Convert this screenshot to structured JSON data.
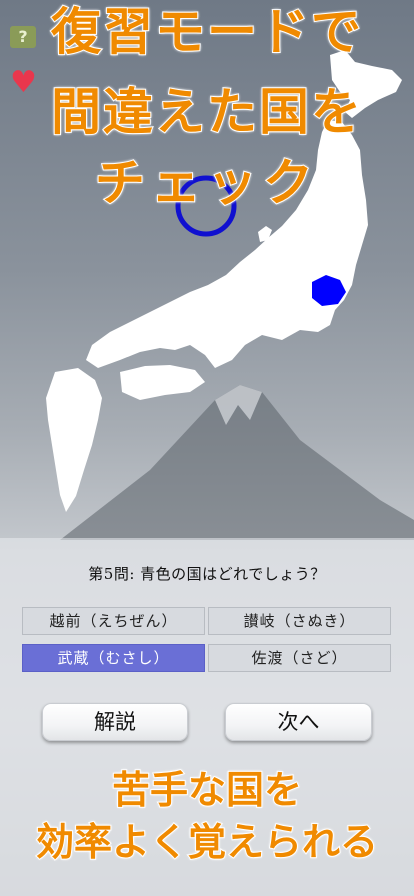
{
  "promo_top": {
    "line1": "復習モードで",
    "line2": "間違えた国を",
    "line3": "チェック"
  },
  "promo_bottom": {
    "line1": "苦手な国を",
    "line2": "効率よく覚えられる"
  },
  "icons": {
    "hint": "?",
    "favorite": "heart-icon"
  },
  "map": {
    "highlight_color": "#0000ff",
    "land_color": "#ffffff",
    "marker_color": "#1010d0"
  },
  "quiz": {
    "question": "第5問: 青色の国はどれでしょう？",
    "options": [
      {
        "label": "越前（えちぜん）",
        "selected": false
      },
      {
        "label": "讃岐（さぬき）",
        "selected": false
      },
      {
        "label": "武蔵（むさし）",
        "selected": true
      },
      {
        "label": "佐渡（さど）",
        "selected": false
      }
    ],
    "explain_label": "解説",
    "next_label": "次へ"
  }
}
